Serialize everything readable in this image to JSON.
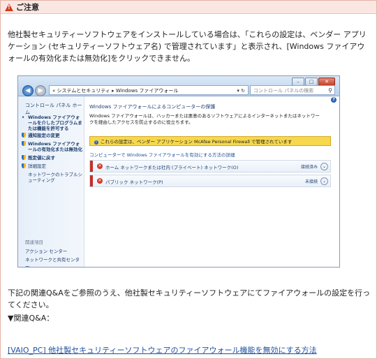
{
  "notice": {
    "title": "ご注意",
    "para1": "他社製セキュリティーソフトウェアをインストールしている場合は、「これらの設定は、ベンダー アプリケーション (セキュリティーソフトウェア名) で管理されています」と表示され、[Windows ファイアウォールの有効化または無効化]をクリックできません。",
    "para2": "下記の関連Q&Aをご参照のうえ、他社製セキュリティーソフトウェアにてファイアウォールの設定を行ってください。",
    "qa_heading": "▼関連Q&A：",
    "qa_link": "[VAIO_PC] 他社製セキュリティーソフトウェアのファイアウォール機能を無効にする方法"
  },
  "screenshot": {
    "window_buttons": [
      "–",
      "□",
      "✕"
    ],
    "address": "« システムとセキュリティ ▸ Windows ファイアウォール",
    "search_placeholder": "コントロール パネルの検索",
    "left_home": "コントロール パネル ホーム",
    "left_items": [
      "Windows ファイアウォールを介したプログラムまたは機能を許可する",
      "通知設定の変更",
      "Windows ファイアウォールの有効化または無効化",
      "既定値に戻す",
      "詳細設定",
      "ネットワークのトラブルシューティング"
    ],
    "related_label": "関連項目",
    "related_items": [
      "アクション センター",
      "ネットワークと共有センター"
    ],
    "main_title": "Windows ファイアウォールによるコンピューターの保護",
    "main_desc": "Windows ファイアウォールは、ハッカーまたは悪意のあるソフトウェアによるインターネットまたはネットワークを経由したアクセスを防止するのに役立ちます。",
    "banner": "これらの設定は、ベンダー アプリケーション McAfee Personal Firewall で管理されています",
    "help_link": "コンピューターで Windows ファイアウォールを有効にする方法の詳細",
    "networks": [
      {
        "label": "ホーム ネットワークまたは社内 (プライベート) ネットワーク(O)",
        "status": "接続済み"
      },
      {
        "label": "パブリック ネットワーク(P)",
        "status": "未接続"
      }
    ]
  },
  "colors": {
    "notice_header_bg": "#fbe7e2",
    "warning_icon": "#d9381e",
    "link": "#1d4f9e",
    "banner": "#f7d84c",
    "alert_bar": "#c0302a"
  }
}
